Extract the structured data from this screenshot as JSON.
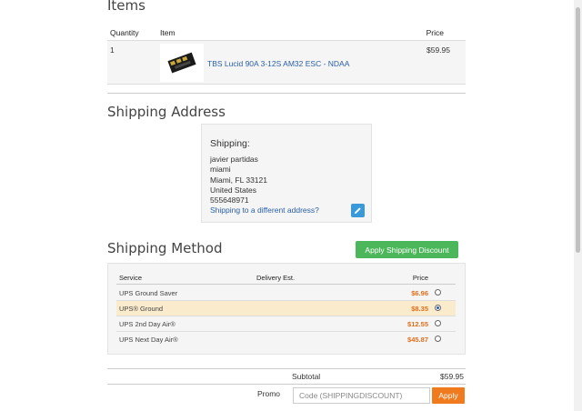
{
  "items_section": {
    "title": "Items",
    "headers": {
      "quantity": "Quantity",
      "item": "Item",
      "price": "Price"
    },
    "rows": [
      {
        "quantity": "1",
        "name": "TBS Lucid 90A 3-12S AM32 ESC - NDAA",
        "price": "$59.95"
      }
    ]
  },
  "shipping_address": {
    "title": "Shipping Address",
    "label": "Shipping:",
    "lines": [
      "javier partidas",
      "miami",
      "Miami, FL 33121",
      "United States",
      "555648971"
    ],
    "different_link": "Shipping to a different address?",
    "edit_icon": "pencil-icon"
  },
  "shipping_method": {
    "title": "Shipping Method",
    "discount_button": "Apply Shipping Discount",
    "headers": {
      "service": "Service",
      "delivery": "Delivery Est.",
      "price": "Price"
    },
    "options": [
      {
        "service": "UPS Ground Saver",
        "price": "$6.96",
        "selected": false
      },
      {
        "service": "UPS® Ground",
        "price": "$8.35",
        "selected": true
      },
      {
        "service": "UPS 2nd Day Air®",
        "price": "$12.55",
        "selected": false
      },
      {
        "service": "UPS Next Day Air®",
        "price": "$45.87",
        "selected": false
      }
    ],
    "price_color": "#e06e1a",
    "selected_bg": "#faebcc"
  },
  "totals": {
    "subtotal_label": "Subtotal",
    "subtotal_value": "$59.95",
    "promo_label": "Promo",
    "promo_placeholder": "Code (SHIPPINGDISCOUNT)",
    "apply_button": "Apply"
  },
  "colors": {
    "apply": "#f07b1f",
    "discount": "#4cb75a",
    "link": "#2a5fa8"
  }
}
